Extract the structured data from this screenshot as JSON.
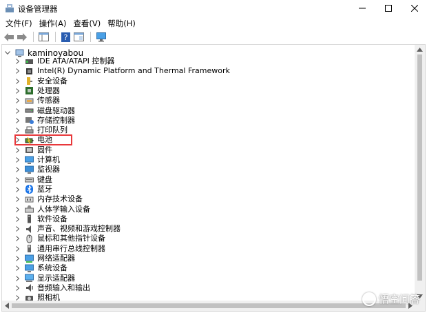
{
  "window": {
    "title": "设备管理器",
    "controls": [
      "minimize",
      "maximize",
      "close"
    ]
  },
  "menubar": {
    "items": [
      {
        "label": "文件(F)"
      },
      {
        "label": "操作(A)"
      },
      {
        "label": "查看(V)"
      },
      {
        "label": "帮助(H)"
      }
    ]
  },
  "toolbar": {
    "icons": [
      "back-arrow-icon",
      "forward-arrow-icon",
      "properties-panel-icon",
      "help-icon",
      "show-panel-icon",
      "monitor-icon"
    ]
  },
  "tree": {
    "root": "kaminoyabou",
    "items": [
      {
        "label": "IDE ATA/ATAPI 控制器",
        "icon": "ide-controller-icon"
      },
      {
        "label": "Intel(R) Dynamic Platform and Thermal Framework",
        "icon": "chip-icon"
      },
      {
        "label": "安全设备",
        "icon": "security-key-icon"
      },
      {
        "label": "处理器",
        "icon": "processor-icon"
      },
      {
        "label": "传感器",
        "icon": "sensor-icon"
      },
      {
        "label": "磁盘驱动器",
        "icon": "disk-drive-icon"
      },
      {
        "label": "存储控制器",
        "icon": "storage-controller-icon"
      },
      {
        "label": "打印队列",
        "icon": "printer-icon"
      },
      {
        "label": "电池",
        "icon": "battery-icon",
        "highlighted": true
      },
      {
        "label": "固件",
        "icon": "firmware-icon"
      },
      {
        "label": "计算机",
        "icon": "computer-icon"
      },
      {
        "label": "监视器",
        "icon": "monitor-icon"
      },
      {
        "label": "键盘",
        "icon": "keyboard-icon"
      },
      {
        "label": "蓝牙",
        "icon": "bluetooth-icon"
      },
      {
        "label": "内存技术设备",
        "icon": "memory-device-icon"
      },
      {
        "label": "人体学输入设备",
        "icon": "hid-icon"
      },
      {
        "label": "软件设备",
        "icon": "software-device-icon"
      },
      {
        "label": "声音、视频和游戏控制器",
        "icon": "speaker-icon"
      },
      {
        "label": "鼠标和其他指针设备",
        "icon": "mouse-icon"
      },
      {
        "label": "通用串行总线控制器",
        "icon": "usb-icon"
      },
      {
        "label": "网络适配器",
        "icon": "network-adapter-icon"
      },
      {
        "label": "系统设备",
        "icon": "system-device-icon"
      },
      {
        "label": "显示适配器",
        "icon": "display-adapter-icon"
      },
      {
        "label": "音频输入和输出",
        "icon": "audio-io-icon"
      },
      {
        "label": "照相机",
        "icon": "camera-icon"
      }
    ]
  },
  "watermark": {
    "text": "悟空问答"
  },
  "colors": {
    "highlight_border": "#e8383b",
    "bluetooth": "#1a74e8",
    "monitor": "#3c8fd8"
  }
}
